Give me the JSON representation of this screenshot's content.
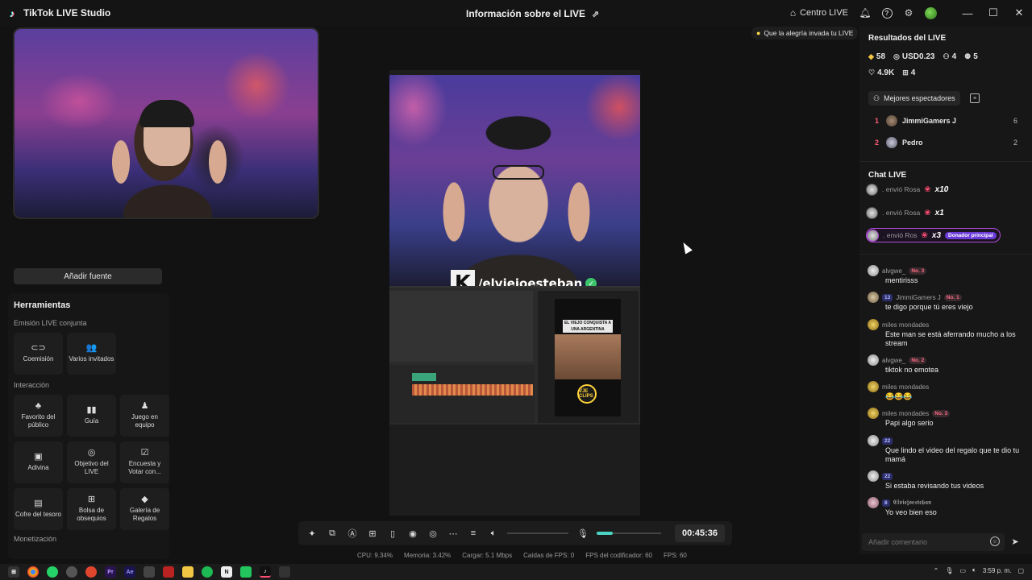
{
  "titlebar": {
    "app_name": "TikTok LIVE Studio",
    "center_title": "Información sobre el LIVE",
    "live_center_label": "Centro LIVE",
    "icons": [
      "share-icon",
      "home-icon",
      "bell-icon",
      "help-icon",
      "settings-icon",
      "avatar",
      "minimize-icon",
      "maximize-icon",
      "close-icon"
    ]
  },
  "left": {
    "add_source_label": "Añadir fuente",
    "tools_title": "Herramientas",
    "sections": [
      {
        "title": "Emisión LIVE conjunta",
        "tools": [
          {
            "label": "Coemisión",
            "icon": "link-icon",
            "glyph": "⊂⊃"
          },
          {
            "label": "Varios invitados",
            "icon": "users-icon",
            "glyph": "👥"
          }
        ]
      },
      {
        "title": "Interacción",
        "tools": [
          {
            "label": "Favorito del público",
            "icon": "fan-icon",
            "glyph": "♣"
          },
          {
            "label": "Guía",
            "icon": "guide-icon",
            "glyph": "▮▮"
          },
          {
            "label": "Juego en equipo",
            "icon": "team-icon",
            "glyph": "♟"
          },
          {
            "label": "Adivina",
            "icon": "guess-icon",
            "glyph": "▣"
          },
          {
            "label": "Objetivo del LIVE",
            "icon": "target-icon",
            "glyph": "◎"
          },
          {
            "label": "Encuesta y Votar con...",
            "icon": "poll-icon",
            "glyph": "☑"
          },
          {
            "label": "Cofre del tesoro",
            "icon": "chest-icon",
            "glyph": "▤"
          },
          {
            "label": "Bolsa de obsequios",
            "icon": "gift-bag-icon",
            "glyph": "⊞"
          },
          {
            "label": "Galería de Regalos",
            "icon": "gallery-icon",
            "glyph": "◆"
          }
        ]
      }
    ],
    "monetization_title": "Monetización"
  },
  "preview": {
    "watermark_text": "/elviejoesteban",
    "editor_banner": "EL VIEJO CONQUISTA A UNA ARGENTINA",
    "editor_logo": "VJE CLIPS"
  },
  "controls": {
    "icons": [
      "magic-icon",
      "scene-icon",
      "text-icon",
      "add-media-icon",
      "phone-icon",
      "record-icon",
      "camera-icon",
      "more-icon",
      "equalizer-icon",
      "volume-icon",
      "mic-icon"
    ],
    "volume_level": 0,
    "mic_level": 0.25,
    "timer": "00:45:36"
  },
  "stats": [
    "CPU:  9.34%",
    "Memoria:  3.42%",
    "Cargar:  5.1 Mbps",
    "Caídas de FPS:  0",
    "FPS del codificador:  60",
    "FPS:  60"
  ],
  "right": {
    "hint": "Que la alegría invada tu LIVE",
    "results_title": "Resultados del LIVE",
    "stats_row1": [
      {
        "icon": "diamond-icon",
        "glyph": "◆",
        "value": "58"
      },
      {
        "icon": "coin-icon",
        "glyph": "◎",
        "value": "USD0.23"
      },
      {
        "icon": "viewers-icon",
        "glyph": "⚇",
        "value": "4"
      },
      {
        "icon": "new-followers-icon",
        "glyph": "⚉",
        "value": "5"
      }
    ],
    "stats_row2": [
      {
        "icon": "heart-icon",
        "glyph": "♡",
        "value": "4.9K"
      },
      {
        "icon": "gift-icon",
        "glyph": "⊞",
        "value": "4"
      }
    ],
    "best_viewers_label": "Mejores espectadores",
    "viewers": [
      {
        "rank": "1",
        "name": "JimmiGamers J",
        "count": "6"
      },
      {
        "rank": "2",
        "name": "Pedro",
        "count": "2"
      }
    ],
    "chat_title": "Chat LIVE",
    "gifts": [
      {
        "text": ". envió Rosa",
        "mult": "x10"
      },
      {
        "text": ". envió Rosa",
        "mult": "x1"
      },
      {
        "text": ". envió Ros",
        "mult": "x3",
        "badge": "Donador principal"
      }
    ],
    "messages": [
      {
        "user": "alvgwe_",
        "badge": "No. 3",
        "level": "",
        "text": "mentirisss"
      },
      {
        "user": "JimmiGamers J",
        "badge": "No. 1",
        "level": "13",
        "text": "te digo porque tú eres viejo"
      },
      {
        "user": "miles mondades",
        "badge": "",
        "level": "",
        "text": "Este man se está aferrando mucho a los stream"
      },
      {
        "user": "alvgwe_",
        "badge": "No. 2",
        "level": "",
        "text": "tiktok no emotea"
      },
      {
        "user": "miles mondades",
        "badge": "",
        "level": "",
        "text": "😂😂😂"
      },
      {
        "user": "miles mondades",
        "badge": "No. 3",
        "level": "",
        "text": "Papi algo serio"
      },
      {
        "user": "",
        "badge": "",
        "level": "22",
        "text": "Que lindo el video del regalo que te dio tu mamá"
      },
      {
        "user": "",
        "badge": "",
        "level": "22",
        "text": "Si estaba revisando tus videos"
      },
      {
        "user": "𝕰𝖑𝖛𝖎𝖊𝖏𝖔𝖊𝖘𝖙𝖊𝖇𝖆𝖓",
        "badge": "",
        "level": "8",
        "text": "Yo veo bien eso"
      }
    ],
    "comment_placeholder": "Añadir comentario"
  },
  "taskbar": {
    "apps": [
      "windows-icon",
      "chrome-icon",
      "whatsapp-icon",
      "browser-icon",
      "app-icon",
      "premiere-icon",
      "after-effects-icon",
      "app-icon-2",
      "app-icon-3",
      "folder-icon",
      "spotify-icon",
      "notion-icon",
      "capcut-icon",
      "tiktok-icon",
      "app-icon-4"
    ],
    "time": "3:59 p. m."
  }
}
